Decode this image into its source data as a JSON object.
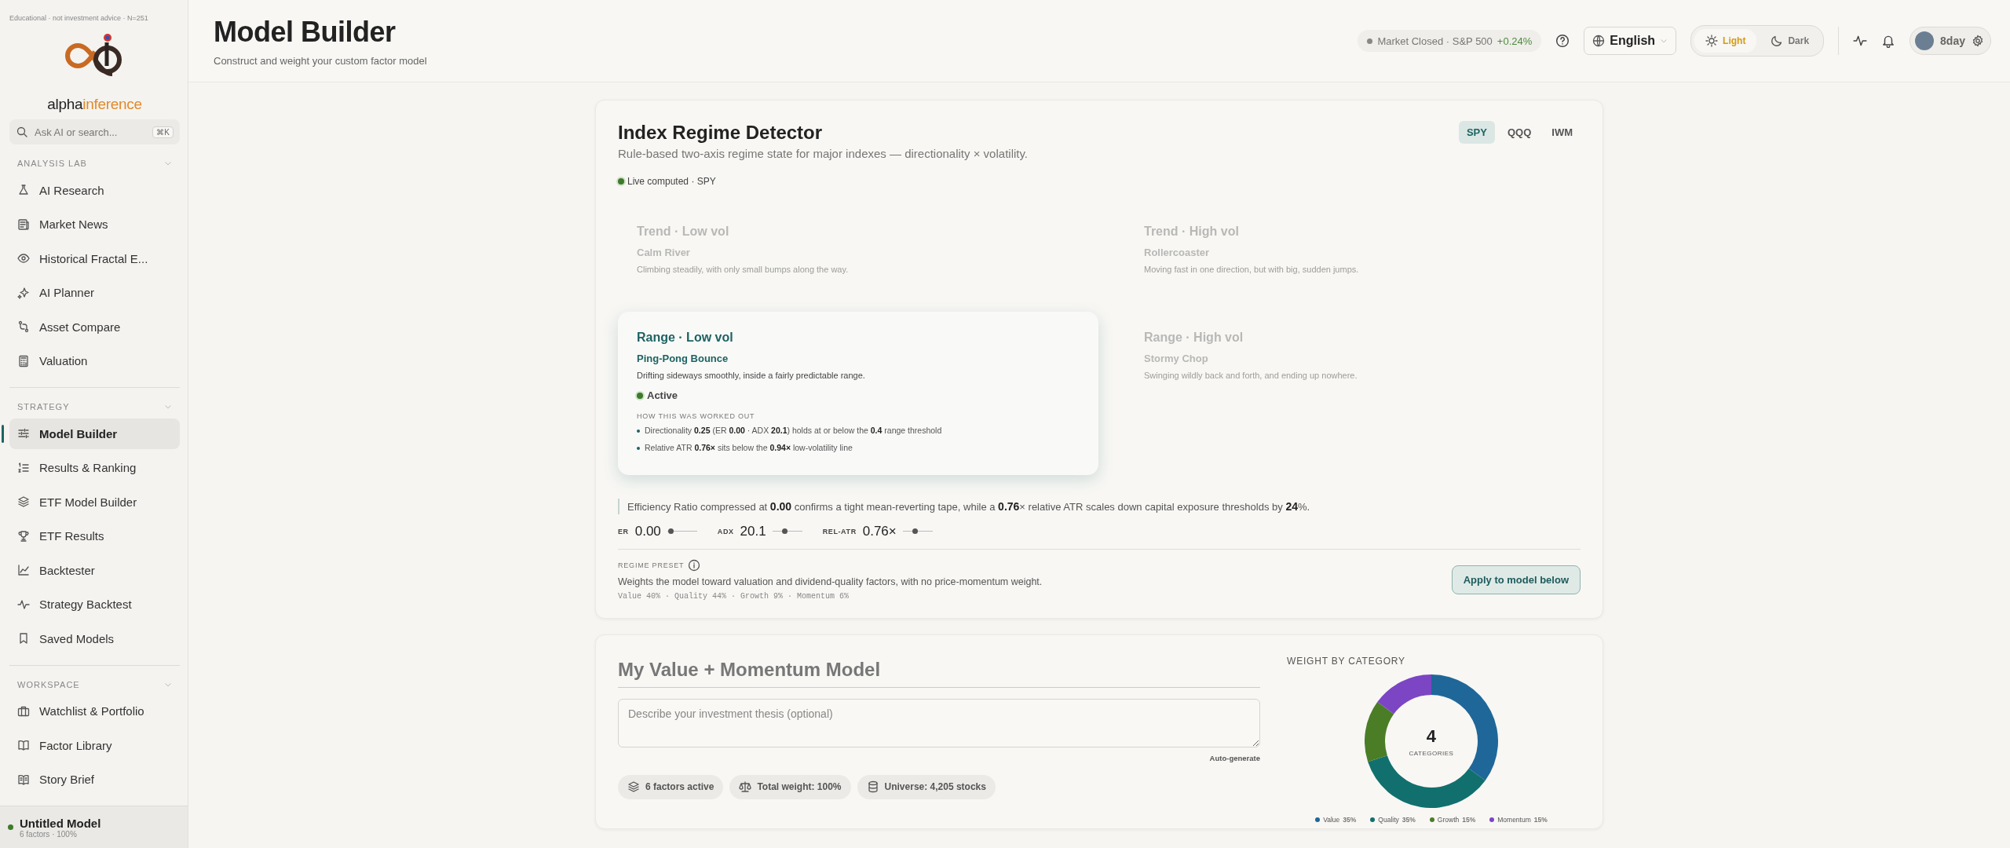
{
  "sidebar": {
    "disclaimer": "Educational · not investment advice · N=251",
    "brand": [
      "alpha",
      "inference"
    ],
    "search": {
      "placeholder": "Ask AI or search...",
      "shortcut": "⌘K"
    },
    "sections": [
      {
        "title": "ANALYSIS LAB",
        "expanded": true,
        "items": [
          {
            "label": "AI Research",
            "selected": false
          },
          {
            "label": "Market News",
            "selected": false
          },
          {
            "label": "Historical Fractal E...",
            "selected": false
          },
          {
            "label": "AI Planner",
            "selected": false
          },
          {
            "label": "Asset Compare",
            "selected": false
          },
          {
            "label": "Valuation",
            "selected": false
          }
        ]
      },
      {
        "title": "STRATEGY",
        "expanded": true,
        "items": [
          {
            "label": "Model Builder",
            "selected": true
          },
          {
            "label": "Results & Ranking",
            "selected": false
          },
          {
            "label": "ETF Model Builder",
            "selected": false
          },
          {
            "label": "ETF Results",
            "selected": false
          },
          {
            "label": "Backtester",
            "selected": false
          },
          {
            "label": "Strategy Backtest",
            "selected": false
          },
          {
            "label": "Saved Models",
            "selected": false
          }
        ]
      },
      {
        "title": "WORKSPACE",
        "expanded": true,
        "items": [
          {
            "label": "Watchlist & Portfolio",
            "selected": false
          },
          {
            "label": "Factor Library",
            "selected": false
          },
          {
            "label": "Story Brief",
            "selected": false
          }
        ]
      }
    ],
    "footer": {
      "title": "Untitled Model",
      "subtitle": "6 factors · 100%"
    }
  },
  "header": {
    "title": "Model Builder",
    "subtitle": "Construct and weight your custom factor model",
    "market": {
      "status": "Market Closed · S&P 500",
      "change": "+0.24%"
    },
    "language": "English",
    "theme": [
      {
        "label": "Light",
        "selected": true
      },
      {
        "label": "Dark",
        "selected": false
      }
    ],
    "user": "8day"
  },
  "regime": {
    "title": "Index Regime Detector",
    "subtitle": "Rule-based two-axis regime state for major indexes — directionality × volatility.",
    "tabs": [
      {
        "label": "SPY",
        "selected": true
      },
      {
        "label": "QQQ",
        "selected": false
      },
      {
        "label": "IWM",
        "selected": false
      }
    ],
    "live": "Live computed · SPY",
    "states": [
      {
        "title": "Trend · Low vol",
        "name": "Calm River",
        "description": "Climbing steadily, with only small bumps along the way.",
        "active": false
      },
      {
        "title": "Trend · High vol",
        "name": "Rollercoaster",
        "description": "Moving fast in one direction, but with big, sudden jumps.",
        "active": false
      },
      {
        "title": "Range · Low vol",
        "name": "Ping-Pong Bounce",
        "description": "Drifting sideways smoothly, inside a fairly predictable range.",
        "active": true,
        "status": "Active",
        "explain_title": "HOW THIS WAS WORKED OUT",
        "explain": [
          "Directionality **0.25** (ER **0.00** · ADX **20.1**) holds at or below the **0.4** range threshold",
          "Relative ATR **0.76×** sits below the **0.94×** low-volatility line"
        ]
      },
      {
        "title": "Range · High vol",
        "name": "Stormy Chop",
        "description": "Swinging wildly back and forth, and ending up nowhere.",
        "active": false
      }
    ],
    "commentary": "Efficiency Ratio compressed at **0.00** confirms a tight mean-reverting tape, while a **0.76**× relative ATR scales down capital exposure thresholds by **24**%.",
    "metrics": [
      {
        "label": "ER",
        "value": "0.00",
        "level": 0.1
      },
      {
        "label": "ADX",
        "value": "20.1",
        "level": 0.4
      },
      {
        "label": "REL-ATR",
        "value": "0.76×",
        "level": 0.4
      }
    ],
    "preset": {
      "label": "REGIME PRESET",
      "description": "Weights the model toward valuation and dividend-quality factors, with no price-momentum weight.",
      "weights": "Value 40% · Quality 44% · Growth 9% · Momentum 6%",
      "button": "Apply to model below"
    }
  },
  "model": {
    "name": "My Value + Momentum Model",
    "thesis_placeholder": "Describe your investment thesis (optional)",
    "autogenerate": "Auto-generate",
    "chips": [
      "6 factors active",
      "Total weight: 100%",
      "Universe: 4,205 stocks"
    ],
    "weights": {
      "title": "WEIGHT BY CATEGORY",
      "center_value": "4",
      "center_label": "CATEGORIES",
      "chart_data": {
        "type": "donut",
        "categories": [
          "Value",
          "Quality",
          "Growth",
          "Momentum"
        ],
        "values": [
          35,
          35,
          15,
          15
        ]
      },
      "legend": [
        {
          "value": "35%",
          "color": "#1f6799"
        },
        {
          "value": "35%",
          "color": "#11706e"
        },
        {
          "value": "15%",
          "color": "#4b7d26"
        },
        {
          "value": "15%",
          "color": "#7c45c4"
        }
      ]
    }
  }
}
